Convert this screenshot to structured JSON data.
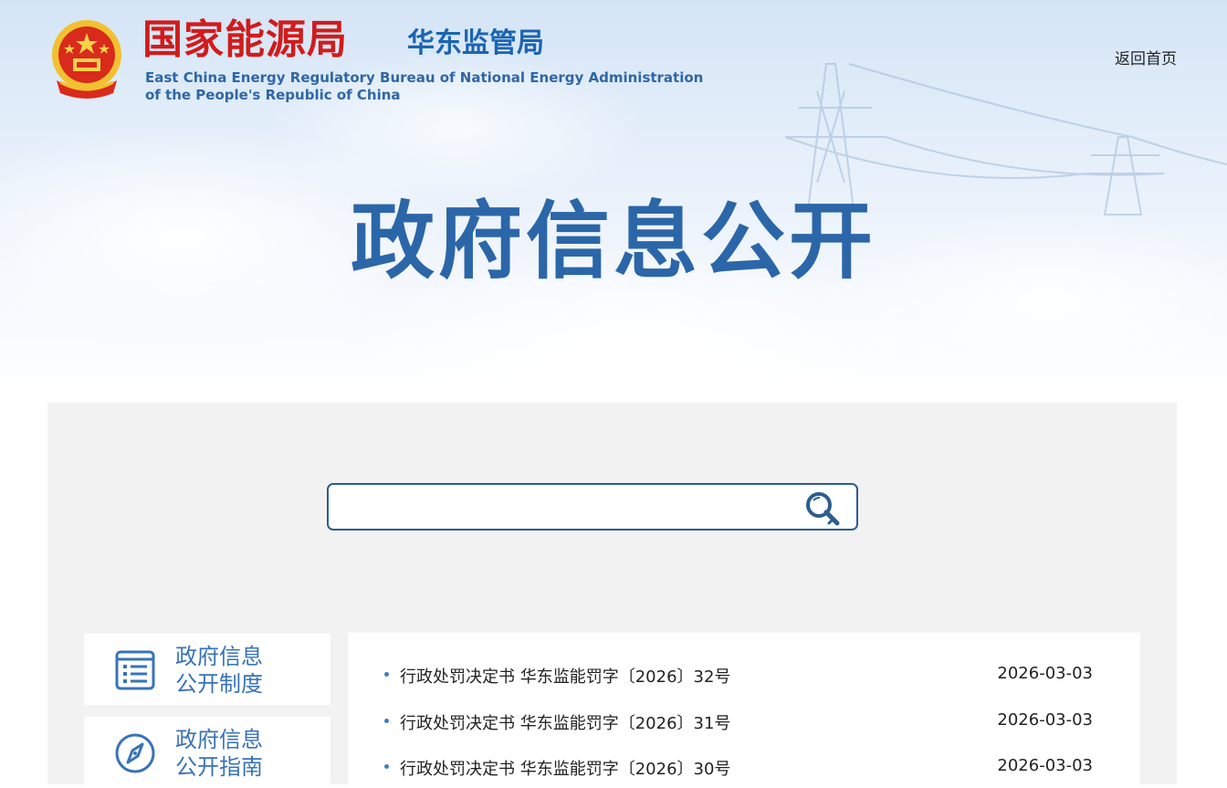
{
  "header": {
    "org_name_cn": "国家能源局",
    "org_sub_cn": "华东监管局",
    "org_name_en_line1": "East China Energy Regulatory Bureau of National Energy Administration",
    "org_name_en_line2": "of the People's Republic of China",
    "home_link": "返回首页",
    "emblem_icon": "national-emblem-icon"
  },
  "hero": {
    "title": "政府信息公开"
  },
  "search": {
    "value": "",
    "placeholder": "",
    "button_icon": "search-icon"
  },
  "sidebar": {
    "items": [
      {
        "label_line1": "政府信息",
        "label_line2": "公开制度",
        "icon": "document-list-icon"
      },
      {
        "label_line1": "政府信息",
        "label_line2": "公开指南",
        "icon": "compass-icon"
      }
    ]
  },
  "news": {
    "items": [
      {
        "title": "行政处罚决定书 华东监能罚字〔2026〕32号",
        "date": "2026-03-03"
      },
      {
        "title": "行政处罚决定书 华东监能罚字〔2026〕31号",
        "date": "2026-03-03"
      },
      {
        "title": "行政处罚决定书 华东监能罚字〔2026〕30号",
        "date": "2026-03-03"
      }
    ]
  },
  "colors": {
    "brand_red": "#d21b1b",
    "brand_blue": "#2b66a8",
    "panel_bg": "#f2f2f2"
  }
}
